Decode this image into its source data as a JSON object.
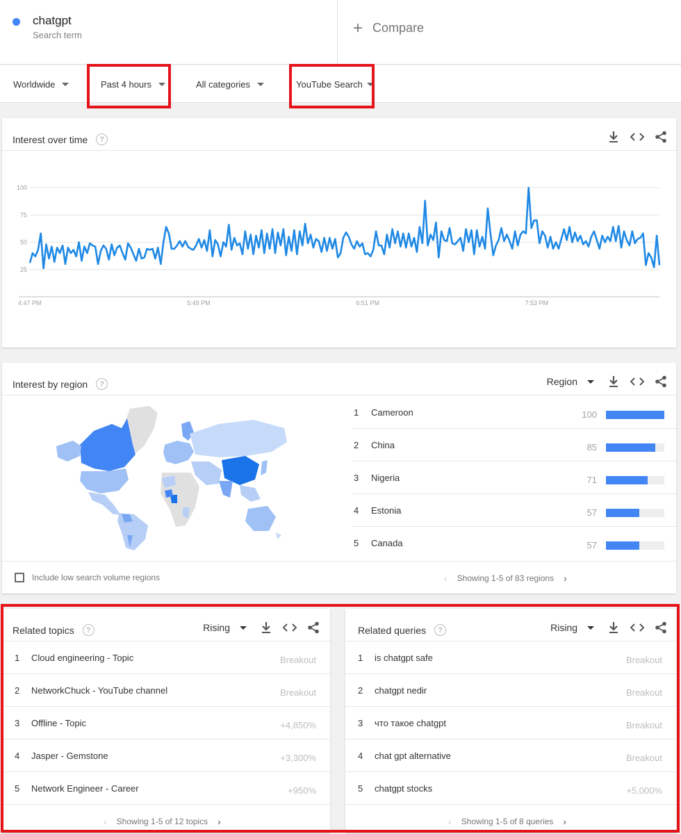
{
  "search_term": {
    "name": "chatgpt",
    "sub": "Search term",
    "dot_color": "#4285f4"
  },
  "compare": {
    "plus": "+",
    "label": "Compare"
  },
  "filters": {
    "location": "Worldwide",
    "time": "Past 4 hours",
    "category": "All categories",
    "property": "YouTube Search"
  },
  "interest_over_time": {
    "title": "Interest over time",
    "help": "?"
  },
  "chart_data": {
    "type": "line",
    "title": "Interest over time",
    "xlabel": "",
    "ylabel": "",
    "ylim": [
      0,
      100
    ],
    "yticks": [
      25,
      50,
      75,
      100
    ],
    "xtick_labels": [
      "4:47 PM",
      "5:49 PM",
      "6:51 PM",
      "7:53 PM"
    ],
    "xtick_index": [
      0,
      62,
      124,
      186
    ],
    "grid": true,
    "line_color": "#1e88e5",
    "series": [
      {
        "values": [
          31,
          40,
          37,
          43,
          58,
          26,
          48,
          35,
          46,
          32,
          45,
          40,
          47,
          30,
          45,
          40,
          43,
          37,
          50,
          33,
          46,
          40,
          49,
          47,
          46,
          30,
          42,
          47,
          44,
          34,
          48,
          38,
          45,
          47,
          40,
          34,
          49,
          45,
          39,
          33,
          44,
          35,
          36,
          44,
          43,
          44,
          35,
          45,
          30,
          50,
          64,
          58,
          44,
          44,
          47,
          51,
          46,
          51,
          46,
          44,
          43,
          47,
          53,
          45,
          52,
          42,
          61,
          37,
          52,
          48,
          37,
          50,
          46,
          66,
          43,
          54,
          47,
          49,
          39,
          60,
          44,
          57,
          39,
          56,
          45,
          61,
          40,
          58,
          44,
          62,
          40,
          59,
          47,
          62,
          38,
          55,
          42,
          61,
          39,
          60,
          47,
          67,
          49,
          57,
          45,
          53,
          51,
          41,
          54,
          42,
          54,
          44,
          53,
          36,
          40,
          54,
          59,
          55,
          48,
          44,
          51,
          46,
          49,
          39,
          40,
          37,
          43,
          60,
          47,
          47,
          39,
          57,
          45,
          62,
          49,
          60,
          46,
          58,
          45,
          58,
          46,
          54,
          41,
          64,
          49,
          88,
          47,
          57,
          52,
          68,
          36,
          60,
          52,
          51,
          63,
          49,
          48,
          51,
          54,
          42,
          62,
          50,
          61,
          39,
          61,
          46,
          55,
          44,
          81,
          58,
          38,
          47,
          52,
          63,
          51,
          57,
          51,
          44,
          60,
          47,
          57,
          60,
          58,
          100,
          63,
          70,
          70,
          49,
          60,
          56,
          45,
          55,
          44,
          50,
          44,
          53,
          62,
          52,
          64,
          50,
          59,
          51,
          56,
          48,
          51,
          46,
          55,
          60,
          52,
          44,
          56,
          50,
          55,
          51,
          64,
          51,
          65,
          45,
          60,
          52,
          47,
          60,
          49,
          53,
          54,
          58,
          29,
          40,
          36,
          27,
          56,
          29
        ]
      }
    ]
  },
  "interest_by_region": {
    "title": "Interest by region",
    "help": "?",
    "select": "Region",
    "bar_color": "#4285f4",
    "rows": [
      {
        "rank": "1",
        "name": "Cameroon",
        "value": "100",
        "pct": 100
      },
      {
        "rank": "2",
        "name": "China",
        "value": "85",
        "pct": 85
      },
      {
        "rank": "3",
        "name": "Nigeria",
        "value": "71",
        "pct": 71
      },
      {
        "rank": "4",
        "name": "Estonia",
        "value": "57",
        "pct": 57
      },
      {
        "rank": "5",
        "name": "Canada",
        "value": "57",
        "pct": 57
      }
    ],
    "low_volume": "Include low search volume regions",
    "pager": "Showing 1-5 of 83 regions"
  },
  "related_topics": {
    "title": "Related topics",
    "help": "?",
    "select": "Rising",
    "rows": [
      {
        "rank": "1",
        "name": "Cloud engineering - Topic",
        "value": "Breakout"
      },
      {
        "rank": "2",
        "name": "NetworkChuck - YouTube channel",
        "value": "Breakout"
      },
      {
        "rank": "3",
        "name": "Offline - Topic",
        "value": "+4,850%"
      },
      {
        "rank": "4",
        "name": "Jasper - Gemstone",
        "value": "+3,300%"
      },
      {
        "rank": "5",
        "name": "Network Engineer - Career",
        "value": "+950%"
      }
    ],
    "pager": "Showing 1-5 of 12 topics"
  },
  "related_queries": {
    "title": "Related queries",
    "help": "?",
    "select": "Rising",
    "rows": [
      {
        "rank": "1",
        "name": "is chatgpt safe",
        "value": "Breakout"
      },
      {
        "rank": "2",
        "name": "chatgpt nedir",
        "value": "Breakout"
      },
      {
        "rank": "3",
        "name": "что такое chatgpt",
        "value": "Breakout"
      },
      {
        "rank": "4",
        "name": "chat gpt alternative",
        "value": "Breakout"
      },
      {
        "rank": "5",
        "name": "chatgpt stocks",
        "value": "+5,000%"
      }
    ],
    "pager": "Showing 1-5 of 8 queries"
  },
  "icons": {
    "download": "download-icon",
    "embed": "embed-code-icon",
    "share": "share-icon",
    "prev": "chevron-left-icon",
    "next": "chevron-right-icon"
  },
  "highlight_color": "#e5131a",
  "chevrons": {
    "prev": "‹",
    "next": "›"
  }
}
